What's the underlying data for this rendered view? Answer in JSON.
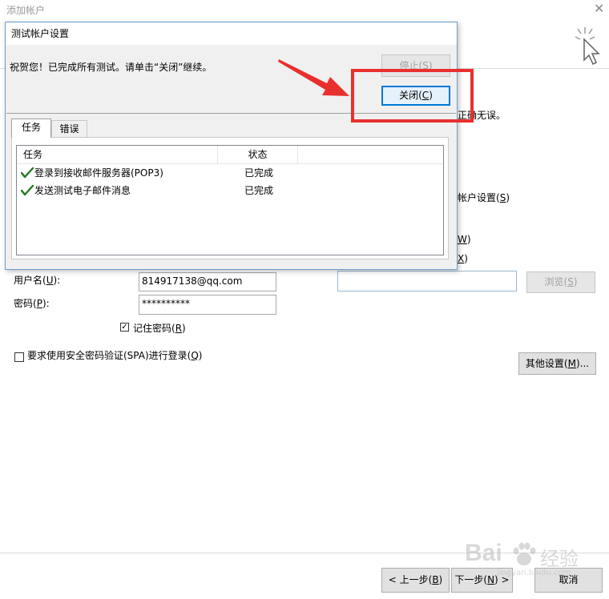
{
  "background_window": {
    "title": "添加帐户",
    "close_glyph": "✕",
    "partial_text_verified": "正确无误。",
    "partial_label_account_settings": "帐户设置(",
    "partial_label_account_settings_key": "S",
    "partial_label_account_settings_end": ")",
    "partial_w": "W",
    "partial_w_end": ")",
    "partial_x": "X",
    "partial_x_end": ")",
    "username_label": "用户名(",
    "username_key": "U",
    "username_label_end": "):",
    "username_value": "814917138@qq.com",
    "password_label": "密码(",
    "password_key": "P",
    "password_label_end": "):",
    "password_value": "**********",
    "remember_label": "记住密码(",
    "remember_key": "R",
    "remember_label_end": ")",
    "remember_checked": true,
    "spa_label": "要求使用安全密码验证(SPA)进行登录(",
    "spa_key": "Q",
    "spa_label_end": ")",
    "spa_checked": false,
    "browse_label": "浏览(",
    "browse_key": "S",
    "browse_label_end": ")",
    "more_settings_label": "其他设置(",
    "more_settings_key": "M",
    "more_settings_label_end": ")...",
    "back_button_label": "< 上一步(",
    "back_key": "B",
    "back_end": ")",
    "next_button_label": "下一步(",
    "next_key": "N",
    "next_end": ") >",
    "cancel_button_label": "取消"
  },
  "test_dialog": {
    "title": "测试帐户设置",
    "message": "祝贺您！已完成所有测试。请单击“关闭”继续。",
    "stop_button_label": "停止(",
    "stop_key": "S",
    "stop_end": ")",
    "close_button_label": "关闭(",
    "close_key": "C",
    "close_end": ")",
    "tabs": [
      {
        "label": "任务",
        "active": true
      },
      {
        "label": "错误",
        "active": false
      }
    ],
    "columns": [
      "任务",
      "状态"
    ],
    "rows": [
      {
        "task": "登录到接收邮件服务器(POP3)",
        "status": "已完成",
        "icon": "checkmark-icon"
      },
      {
        "task": "发送测试电子邮件消息",
        "status": "已完成",
        "icon": "checkmark-icon"
      }
    ]
  },
  "watermark": {
    "text": "Bai",
    "text2": "经验",
    "subtext": "jingyan.baidu.com"
  },
  "colors": {
    "annotation_red": "#e8302f",
    "check_green": "#1e7a1e",
    "default_button_border": "#0078d7"
  }
}
